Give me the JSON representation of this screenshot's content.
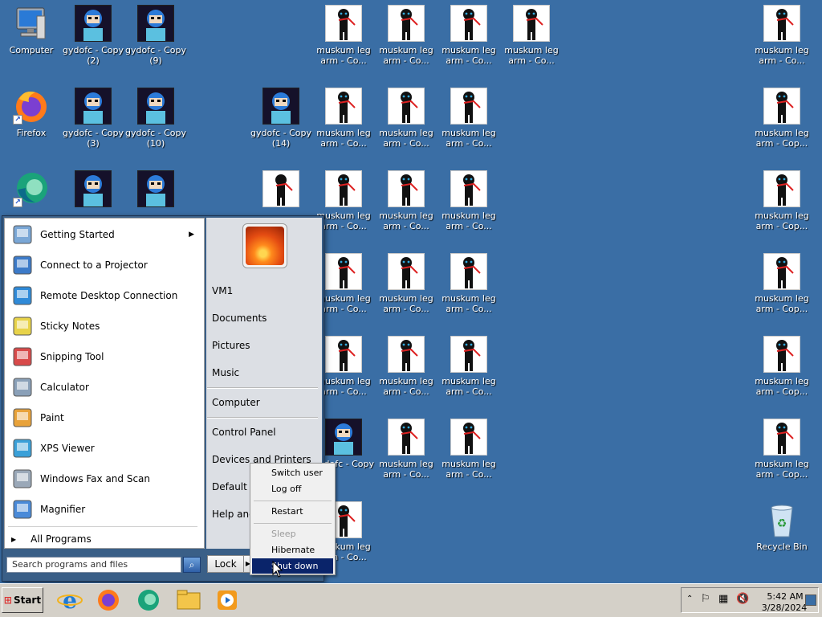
{
  "colors": {
    "desktop_bg": "#3a6ea5",
    "selection": "#0a246a",
    "taskbar": "#d4d0c8"
  },
  "desktop_icons": {
    "computer": "Computer",
    "firefox": "Firefox",
    "edge": "Microsoft Edge",
    "gy2": "gydofc - Copy (2)",
    "gy9": "gydofc - Copy (9)",
    "gy3": "gydofc - Copy (3)",
    "gy10": "gydofc - Copy (10)",
    "gy14": "gydofc - Copy (14)",
    "gy_short": "gydofc - Copy",
    "doll_short": "muskum leg arm - Co...",
    "doll_short2": "muskum leg arm - Cop...",
    "doll_plain": "muskum leg arm - Co...",
    "doll_legarm": "muskum leg arm - Co...",
    "doll_cop": "muskum leg arm - Cop...",
    "doll_partial": "muskum leg",
    "doll_partial2": "- Co...",
    "recycle": "Recycle Bin"
  },
  "start_menu": {
    "programs": [
      {
        "label": "Getting Started",
        "icon": "getting-started-icon",
        "has_submenu": true
      },
      {
        "label": "Connect to a Projector",
        "icon": "projector-icon"
      },
      {
        "label": "Remote Desktop Connection",
        "icon": "remote-desktop-icon"
      },
      {
        "label": "Sticky Notes",
        "icon": "sticky-notes-icon"
      },
      {
        "label": "Snipping Tool",
        "icon": "snipping-tool-icon"
      },
      {
        "label": "Calculator",
        "icon": "calculator-icon"
      },
      {
        "label": "Paint",
        "icon": "paint-icon"
      },
      {
        "label": "XPS Viewer",
        "icon": "xps-viewer-icon"
      },
      {
        "label": "Windows Fax and Scan",
        "icon": "fax-scan-icon"
      },
      {
        "label": "Magnifier",
        "icon": "magnifier-icon"
      }
    ],
    "all_programs": "All Programs",
    "search_placeholder": "Search programs and files",
    "right": {
      "user": "VM1",
      "documents": "Documents",
      "pictures": "Pictures",
      "music": "Music",
      "computer": "Computer",
      "control_panel": "Control Panel",
      "devices": "Devices and Printers",
      "default": "Default P",
      "help": "Help and"
    },
    "lock_label": "Lock"
  },
  "power_menu": {
    "switch_user": "Switch user",
    "log_off": "Log off",
    "restart": "Restart",
    "sleep": "Sleep",
    "hibernate": "Hibernate",
    "shut_down": "Shut down"
  },
  "taskbar": {
    "start_label": "Start",
    "time": "5:42 AM",
    "date": "3/28/2024"
  }
}
